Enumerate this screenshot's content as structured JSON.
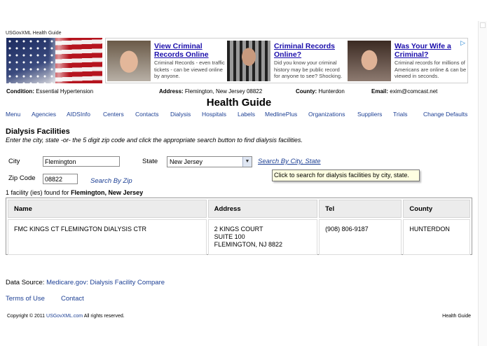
{
  "site_name": "USGovXML Health Guide",
  "ads": [
    {
      "title": "View Criminal Records Online",
      "text": "Criminal Records - even traffic tickets - can be viewed online by anyone."
    },
    {
      "title": "Criminal Records Online?",
      "text": "Did you know your criminal history may be public record for anyone to see? Shocking."
    },
    {
      "title": "Was Your Wife a Criminal?",
      "text": "Criminal records for millions of Americans are online & can be viewed in seconds."
    }
  ],
  "info": {
    "condition_label": "Condition:",
    "condition_value": "Essential Hypertension",
    "address_label": "Address:",
    "address_value": "Flemington, New Jersey 08822",
    "county_label": "County:",
    "county_value": "Hunterdon",
    "email_label": "Email:",
    "email_value": "exim@comcast.net"
  },
  "main_title": "Health Guide",
  "nav": [
    "Menu",
    "Agencies",
    "AIDSInfo",
    "Centers",
    "Contacts",
    "Dialysis",
    "Hospitals",
    "Labels",
    "MedlinePlus",
    "Organizations",
    "Suppliers",
    "Trials",
    "Change Defaults"
  ],
  "section_title": "Dialysis Facilities",
  "instructions": "Enter the city, state -or- the 5 digit zip code and click the appropriate search button to find dialysis facilities.",
  "form": {
    "city_label": "City",
    "city_value": "Flemington",
    "state_label": "State",
    "state_value": "New Jersey",
    "search_city_state": "Search By City, State",
    "zip_label": "Zip Code",
    "zip_value": "08822",
    "search_zip": "Search By Zip"
  },
  "tooltip": "Click to search for dialysis facilities by city, state.",
  "result_count": {
    "prefix": "1 facility (ies) found for",
    "location": "Flemington, New Jersey"
  },
  "results": {
    "headers": [
      "Name",
      "Address",
      "Tel",
      "County"
    ],
    "rows": [
      {
        "name": "FMC KINGS CT FLEMINGTON DIALYSIS CTR",
        "address1": "2 KINGS COURT",
        "address2": "SUITE 100",
        "address3": "FLEMINGTON, NJ 8822",
        "tel": "(908) 806-9187",
        "county": "HUNTERDON"
      }
    ]
  },
  "data_source": {
    "label": "Data Source:",
    "link": "Medicare.gov: Dialysis Facility Compare"
  },
  "footer": {
    "terms": "Terms of Use",
    "contact": "Contact",
    "copyright_prefix": "Copyright © 2011",
    "copyright_link": "USGovXML.com",
    "copyright_suffix": "All rights reserved.",
    "brand": "Health Guide"
  },
  "colors": {
    "link": "#1c3f94",
    "ad_title": "#1a0dab",
    "tooltip_bg": "#ffffe1",
    "header_bg": "#ececec"
  }
}
